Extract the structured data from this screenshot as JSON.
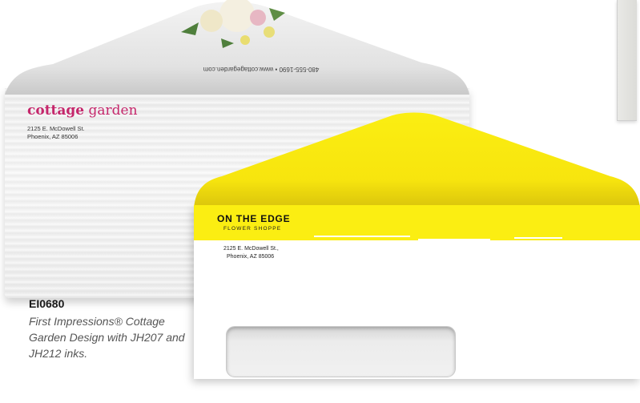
{
  "envelope_one": {
    "phone_web": "480-555-1690 • www.cottagegarden.com",
    "brand_word1": "cottage",
    "brand_word2": "garden",
    "address_line1": "2125 E. McDowell St.",
    "address_line2": "Phoenix, AZ 85006",
    "colors": {
      "brand": "#c5266b"
    }
  },
  "envelope_two": {
    "brand": "ON THE EDGE",
    "subtitle": "FLOWER SHOPPE",
    "address_line1": "2125 E. McDowell St.,",
    "address_line2": "Phoenix, AZ 85006",
    "colors": {
      "band": "#fbee12"
    }
  },
  "caption": {
    "code": "EI0680",
    "description": "First Impressions® Cottage Garden Design with JH207 and JH212 inks."
  }
}
